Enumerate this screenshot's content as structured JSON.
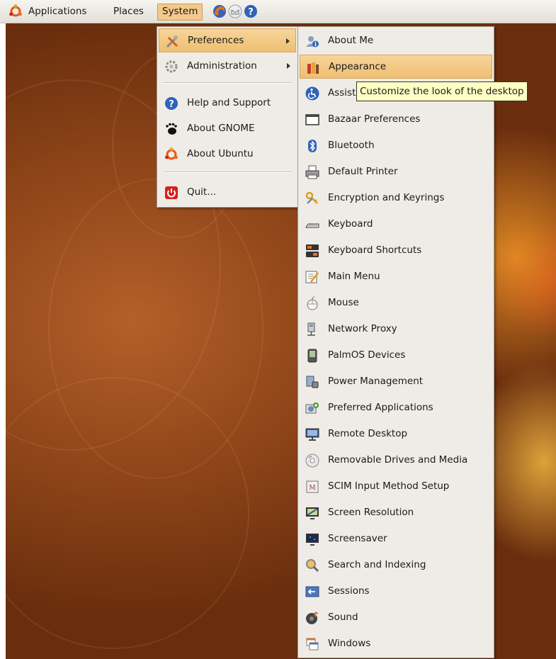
{
  "top_panel": {
    "menus": [
      "Applications",
      "Places",
      "System"
    ],
    "launcher_icons": [
      "firefox-icon",
      "mail-icon",
      "help-icon"
    ]
  },
  "system_menu": {
    "items": [
      {
        "label": "Preferences",
        "icon": "preferences-icon",
        "submenu": true
      },
      {
        "label": "Administration",
        "icon": "administration-icon",
        "submenu": true
      },
      {
        "label": "Help and Support",
        "icon": "help-icon"
      },
      {
        "label": "About GNOME",
        "icon": "gnome-foot-icon"
      },
      {
        "label": "About Ubuntu",
        "icon": "ubuntu-logo-icon"
      },
      {
        "label": "Quit...",
        "icon": "power-icon"
      }
    ]
  },
  "preferences_menu": {
    "items": [
      {
        "label": "About Me",
        "icon": "about-me-icon"
      },
      {
        "label": "Appearance",
        "icon": "appearance-icon"
      },
      {
        "label": "Assistive Technologies",
        "icon": "accessibility-icon"
      },
      {
        "label": "Bazaar Preferences",
        "icon": "window-icon"
      },
      {
        "label": "Bluetooth",
        "icon": "bluetooth-icon"
      },
      {
        "label": "Default Printer",
        "icon": "printer-icon"
      },
      {
        "label": "Encryption and Keyrings",
        "icon": "keyring-icon"
      },
      {
        "label": "Keyboard",
        "icon": "keyboard-icon"
      },
      {
        "label": "Keyboard Shortcuts",
        "icon": "keyboard-shortcuts-icon"
      },
      {
        "label": "Main Menu",
        "icon": "main-menu-icon"
      },
      {
        "label": "Mouse",
        "icon": "mouse-icon"
      },
      {
        "label": "Network Proxy",
        "icon": "network-proxy-icon"
      },
      {
        "label": "PalmOS Devices",
        "icon": "palm-device-icon"
      },
      {
        "label": "Power Management",
        "icon": "power-management-icon"
      },
      {
        "label": "Preferred Applications",
        "icon": "preferred-apps-icon"
      },
      {
        "label": "Remote Desktop",
        "icon": "remote-desktop-icon"
      },
      {
        "label": "Removable Drives and Media",
        "icon": "removable-media-icon"
      },
      {
        "label": "SCIM Input Method Setup",
        "icon": "scim-icon"
      },
      {
        "label": "Screen Resolution",
        "icon": "screen-resolution-icon"
      },
      {
        "label": "Screensaver",
        "icon": "screensaver-icon"
      },
      {
        "label": "Search and Indexing",
        "icon": "search-indexing-icon"
      },
      {
        "label": "Sessions",
        "icon": "sessions-icon"
      },
      {
        "label": "Sound",
        "icon": "sound-icon"
      },
      {
        "label": "Windows",
        "icon": "windows-icon"
      }
    ]
  },
  "tooltip": {
    "text": "Customize the look of the desktop"
  },
  "colors": {
    "highlight": "#f0c27a",
    "menu_bg": "#efece7",
    "tooltip_bg": "#ffffc4",
    "desktop": "#8d4418"
  }
}
